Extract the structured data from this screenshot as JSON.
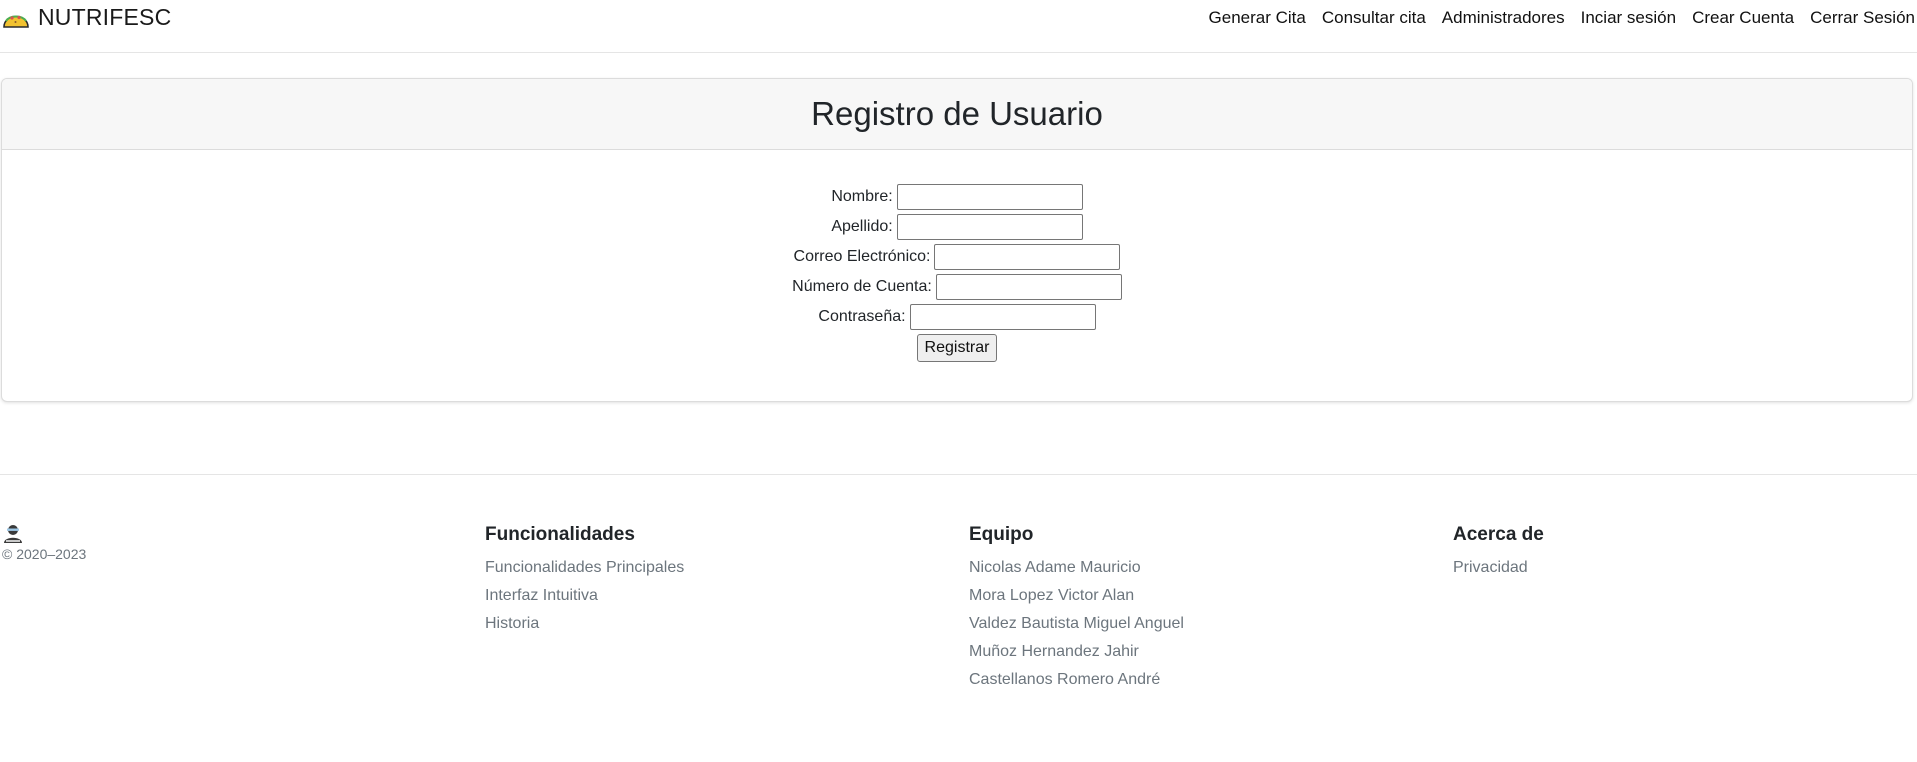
{
  "navbar": {
    "brand": "NUTRIFESC",
    "links": [
      "Generar Cita",
      "Consultar cita",
      "Administradores",
      "Inciar sesión",
      "Crear Cuenta",
      "Cerrar Sesión"
    ]
  },
  "registration": {
    "title": "Registro de Usuario",
    "fields": [
      {
        "label": "Nombre:",
        "value": ""
      },
      {
        "label": "Apellido:",
        "value": ""
      },
      {
        "label": "Correo Electrónico:",
        "value": ""
      },
      {
        "label": "Número de Cuenta:",
        "value": ""
      },
      {
        "label": "Contraseña:",
        "value": ""
      }
    ],
    "submit_label": "Registrar"
  },
  "footer": {
    "copyright": "© 2020–2023",
    "columns": [
      {
        "title": "Funcionalidades",
        "items": [
          "Funcionalidades Principales",
          "Interfaz Intuitiva",
          "Historia"
        ]
      },
      {
        "title": "Equipo",
        "items": [
          "Nicolas Adame Mauricio",
          "Mora Lopez Victor Alan",
          "Valdez Bautista Miguel Anguel",
          "Muñoz Hernandez Jahir",
          "Castellanos Romero André"
        ]
      },
      {
        "title": "Acerca de",
        "items": [
          "Privacidad"
        ]
      }
    ]
  },
  "colors": {
    "text": "#212529",
    "muted": "#6c757d",
    "header_bg": "#f7f7f7",
    "border": "#dcdcdc"
  },
  "icons": {
    "brand": "taco-icon",
    "footer": "person-icon"
  }
}
